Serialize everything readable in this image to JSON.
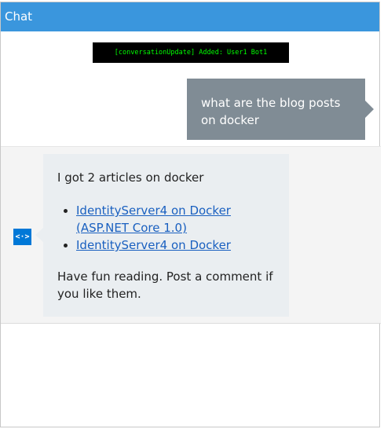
{
  "header": {
    "title": "Chat"
  },
  "event_log": {
    "text": "[conversationUpdate] Added: User1 Bot1"
  },
  "user_message": {
    "text": "what are the blog posts on docker"
  },
  "bot": {
    "avatar_glyph": "<·>",
    "intro": "I got 2 articles on docker",
    "articles": [
      {
        "title": "IdentityServer4 on Docker (ASP.NET Core 1.0)"
      },
      {
        "title": "IdentityServer4 on Docker"
      }
    ],
    "outro": "Have fun reading. Post a comment if you like them."
  },
  "colors": {
    "header_bg": "#3a96dd",
    "user_bubble_bg": "#808c95",
    "bot_bubble_bg": "#eaeef1",
    "bot_avatar_bg": "#0078d7",
    "event_text": "#00ff00",
    "link": "#1a60c0"
  }
}
